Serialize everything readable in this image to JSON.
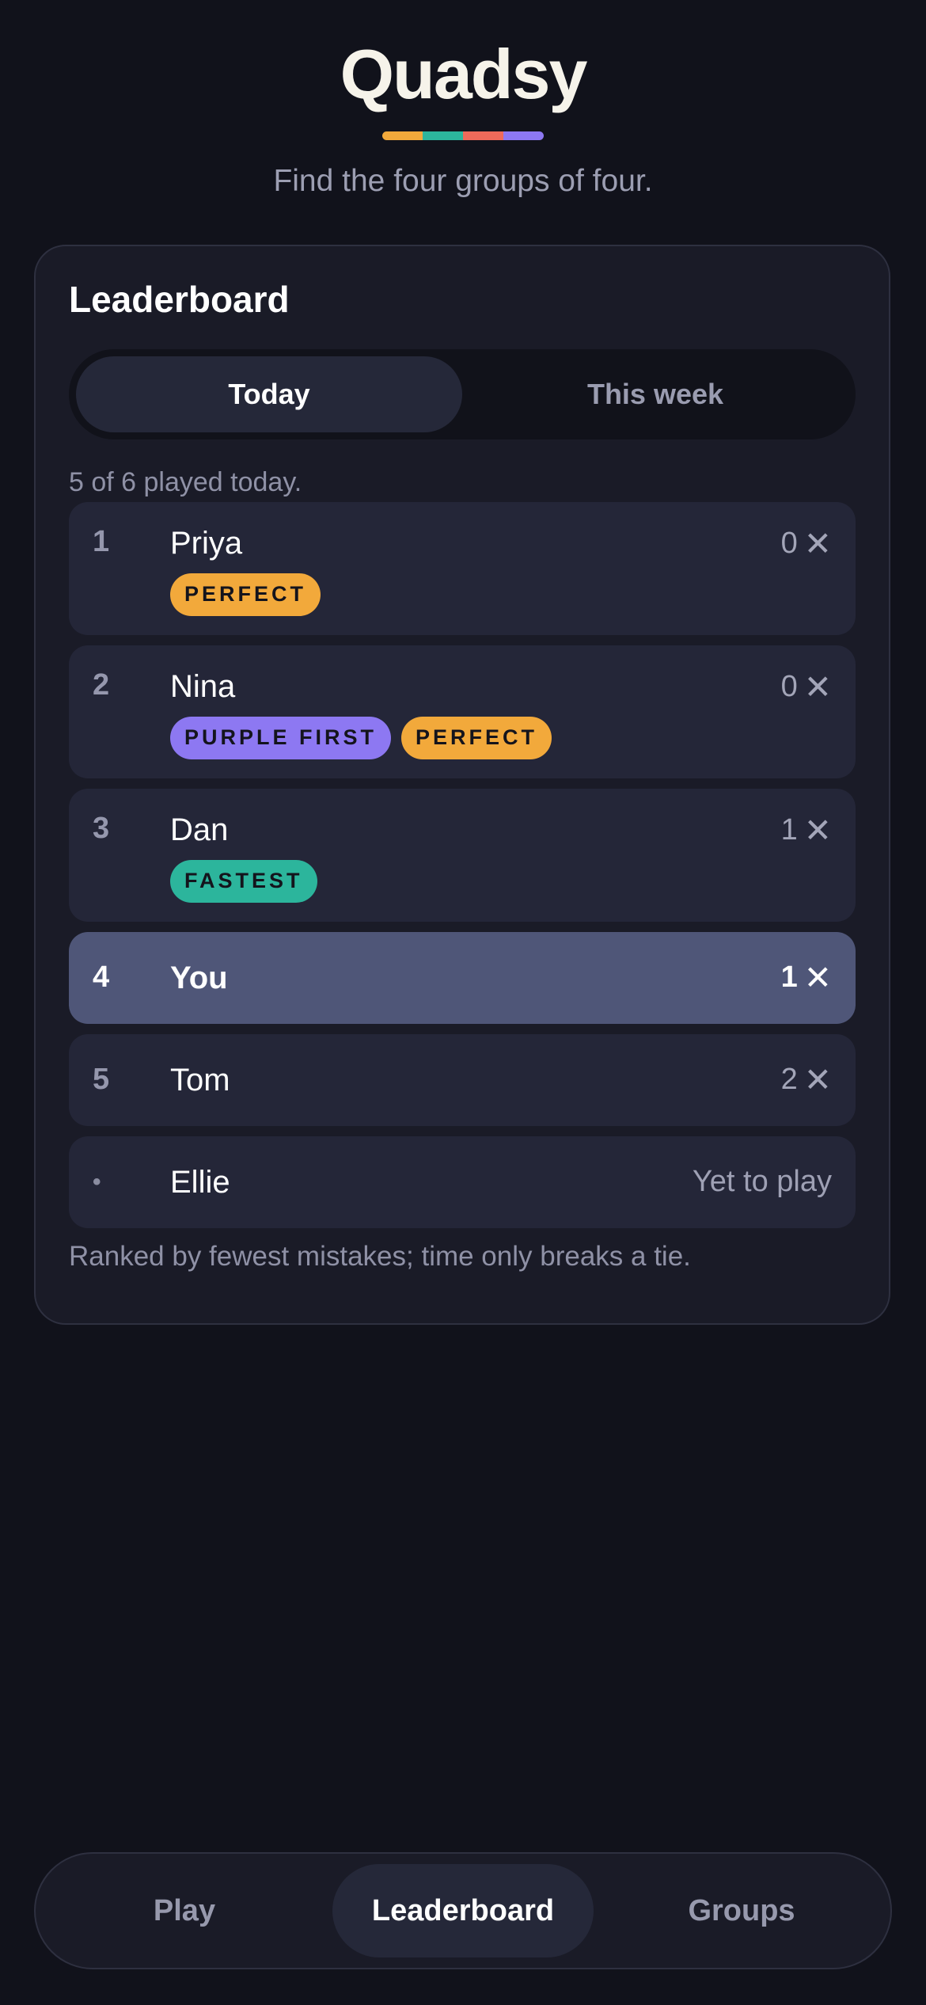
{
  "app": {
    "title": "Quadsy",
    "tagline": "Find the four groups of four.",
    "accent_colors": [
      "#f2a93b",
      "#2cb59c",
      "#ef6a5a",
      "#8d78f2"
    ]
  },
  "leaderboard": {
    "title": "Leaderboard",
    "tabs": [
      {
        "label": "Today",
        "active": true
      },
      {
        "label": "This week",
        "active": false
      }
    ],
    "played_note": "5 of 6 played today.",
    "rows": [
      {
        "rank": "1",
        "name": "Priya",
        "mistakes": "0",
        "badges": [
          {
            "label": "PERFECT",
            "color": "#f2a93b"
          }
        ]
      },
      {
        "rank": "2",
        "name": "Nina",
        "mistakes": "0",
        "badges": [
          {
            "label": "PURPLE FIRST",
            "color": "#8d78f2"
          },
          {
            "label": "PERFECT",
            "color": "#f2a93b"
          }
        ]
      },
      {
        "rank": "3",
        "name": "Dan",
        "mistakes": "1",
        "badges": [
          {
            "label": "FASTEST",
            "color": "#2cb59c"
          }
        ]
      },
      {
        "rank": "4",
        "name": "You",
        "mistakes": "1",
        "highlight": true
      },
      {
        "rank": "5",
        "name": "Tom",
        "mistakes": "2"
      },
      {
        "rank": "•",
        "name": "Ellie",
        "status": "Yet to play"
      }
    ],
    "footnote": "Ranked by fewest mistakes; time only breaks a tie."
  },
  "nav": {
    "tabs": [
      {
        "label": "Play",
        "active": false
      },
      {
        "label": "Leaderboard",
        "active": true
      },
      {
        "label": "Groups",
        "active": false
      }
    ]
  },
  "icons": {
    "mistake": "close-x-icon"
  }
}
